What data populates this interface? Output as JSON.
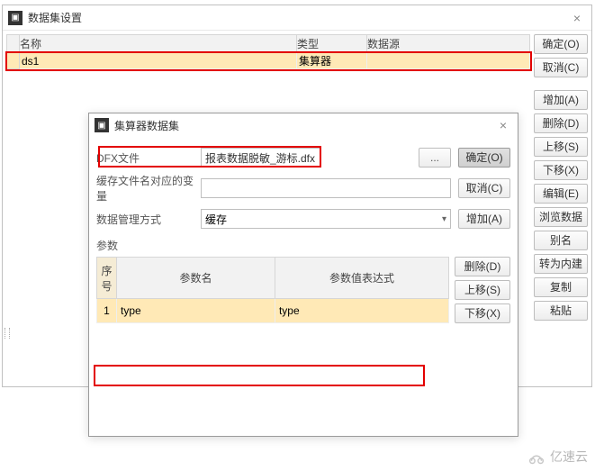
{
  "outer": {
    "title": "数据集设置",
    "columns": {
      "name": "名称",
      "type": "类型",
      "source": "数据源"
    },
    "row": {
      "name": "ds1",
      "type": "集算器",
      "source": ""
    },
    "buttons": {
      "ok": "确定(O)",
      "cancel": "取消(C)",
      "add": "增加(A)",
      "del": "删除(D)",
      "up": "上移(S)",
      "down": "下移(X)",
      "edit": "编辑(E)",
      "browse": "浏览数据",
      "alias": "别名",
      "toBuiltin": "转为内建",
      "copy": "复制",
      "paste": "粘贴"
    }
  },
  "inner": {
    "title": "集算器数据集",
    "labels": {
      "dfx": "DFX文件",
      "cacheVar": "缓存文件名对应的变量",
      "cacheMode": "数据管理方式",
      "params": "参数",
      "seq": "序号",
      "pname": "参数名",
      "pexp": "参数值表达式"
    },
    "fields": {
      "dfx_value": "报表数据脱敏_游标.dfx",
      "cacheVar_value": "",
      "cacheMode_value": "缓存",
      "browse": "..."
    },
    "buttons": {
      "ok": "确定(O)",
      "cancel": "取消(C)",
      "add": "增加(A)",
      "del": "删除(D)",
      "up": "上移(S)",
      "down": "下移(X)"
    },
    "param_row": {
      "num": "1",
      "name": "type",
      "expr": "type"
    }
  },
  "watermark": "亿速云"
}
